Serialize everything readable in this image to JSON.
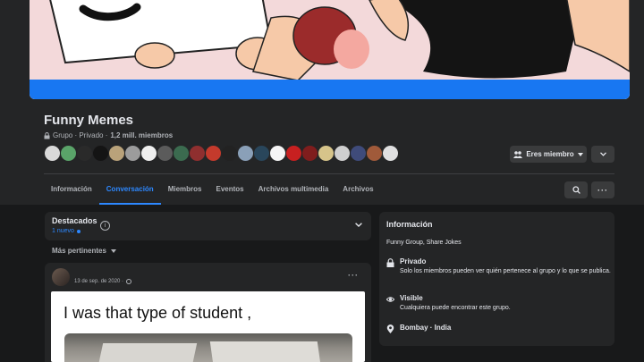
{
  "group": {
    "name": "Funny Memes",
    "meta_prefix": "Grupo · Privado · ",
    "members": "1,2 mill. miembros"
  },
  "avatars": [
    "#d9d9d9",
    "#5aa469",
    "#2a2a2a",
    "#141414",
    "#b9a27a",
    "#9c9c9c",
    "#efefef",
    "#5b5b5b",
    "#3b6b4f",
    "#8f2f2f",
    "#c43a2c",
    "#222222",
    "#8aa0b8",
    "#29465b",
    "#f5f5f5",
    "#c72020",
    "#7f1d1d",
    "#d6c48a",
    "#cfcfcf",
    "#3f4b7a",
    "#a05a3a",
    "#e0e0e0"
  ],
  "actions": {
    "member_label": "Eres miembro"
  },
  "tabs": [
    {
      "label": "Información",
      "active": false
    },
    {
      "label": "Conversación",
      "active": true
    },
    {
      "label": "Miembros",
      "active": false
    },
    {
      "label": "Eventos",
      "active": false
    },
    {
      "label": "Archivos multimedia",
      "active": false
    },
    {
      "label": "Archivos",
      "active": false
    }
  ],
  "featured": {
    "title": "Destacados",
    "new_label": "1 nuevo"
  },
  "sort": {
    "label": "Más pertinentes"
  },
  "post": {
    "date": "13 de sep. de 2020 ·",
    "meme_text": "I was that type of student ,"
  },
  "about": {
    "title": "Información",
    "description": "Funny Group, Share Jokes",
    "privacy_title": "Privado",
    "privacy_desc": "Solo los miembros pueden ver quién pertenece al grupo y lo que se publica.",
    "visible_title": "Visible",
    "visible_desc": "Cualquiera puede encontrar este grupo.",
    "location": "Bombay · India"
  },
  "colors": {
    "accent": "#2d88ff",
    "cover_bar": "#1877f2",
    "background": "#18191a",
    "surface": "#242526"
  }
}
